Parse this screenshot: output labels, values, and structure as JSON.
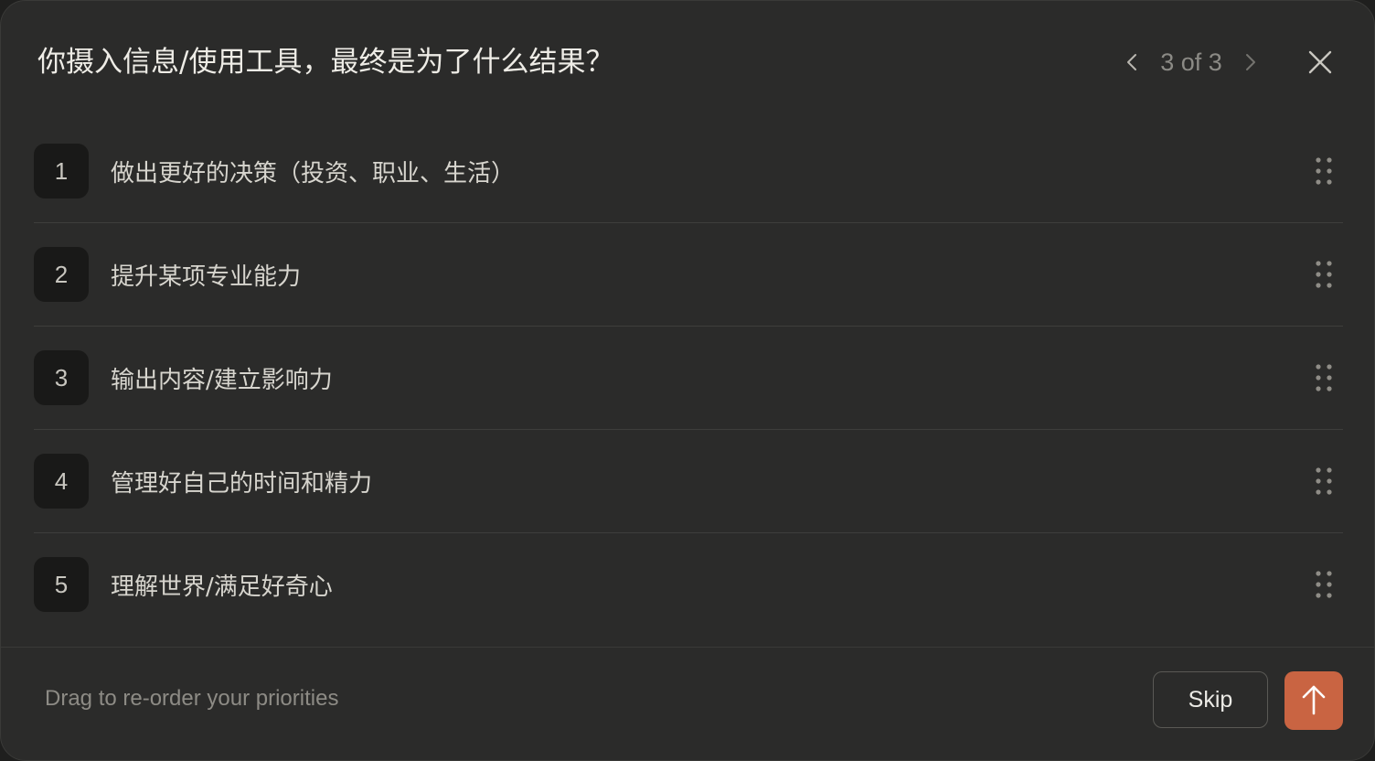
{
  "dialog": {
    "title": "你摄入信息/使用工具，最终是为了什么结果？",
    "pager": {
      "text": "3 of 3",
      "prev_icon": "chevron-left-icon",
      "next_icon": "chevron-right-icon"
    },
    "close_icon": "close-icon"
  },
  "priorities": [
    {
      "rank": "1",
      "label": "做出更好的决策（投资、职业、生活）"
    },
    {
      "rank": "2",
      "label": "提升某项专业能力"
    },
    {
      "rank": "3",
      "label": "输出内容/建立影响力"
    },
    {
      "rank": "4",
      "label": "管理好自己的时间和精力"
    },
    {
      "rank": "5",
      "label": "理解世界/满足好奇心"
    }
  ],
  "footer": {
    "hint": "Drag to re-order your priorities",
    "skip_label": "Skip",
    "submit_icon": "arrow-up-icon"
  },
  "colors": {
    "background": "#2b2b2a",
    "accent": "#c96442",
    "text": "#eeece6",
    "muted": "#8d8b85"
  }
}
